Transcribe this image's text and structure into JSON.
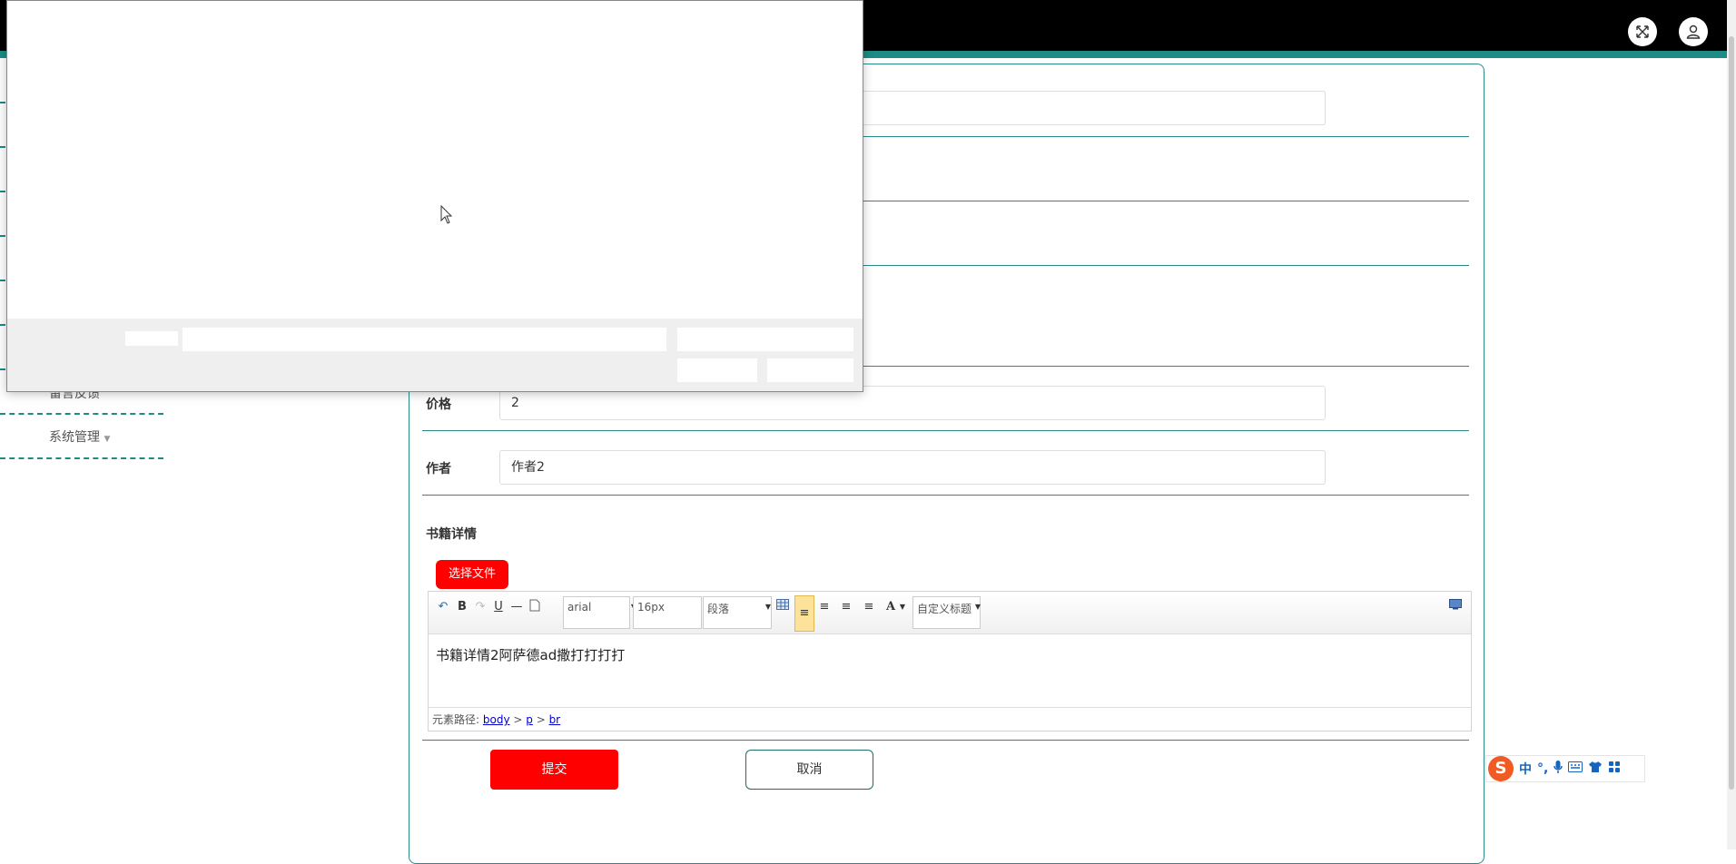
{
  "header": {
    "fullscreen_icon": "expand-arrows-icon",
    "user_icon": "user-icon"
  },
  "sidebar": {
    "items": [
      {
        "label": "留言反馈"
      },
      {
        "label": "系统管理"
      }
    ]
  },
  "form": {
    "price_label": "价格",
    "price_value": "2",
    "author_label": "作者",
    "author_value": "作者2",
    "detail_label": "书籍详情",
    "choose_file_label": "选择文件",
    "submit_label": "提交",
    "cancel_label": "取消"
  },
  "editor": {
    "font_family": "arial",
    "font_size": "16px",
    "paragraph": "段落",
    "custom_title": "自定义标题",
    "content": "书籍详情2阿萨德ad撒打打打打",
    "path_label": "元素路径:",
    "path": [
      "body",
      "p",
      "br"
    ]
  },
  "ime": {
    "logo": "S",
    "mode": "中"
  },
  "colors": {
    "accent": "#1c8c84",
    "primary_button": "#ff0000",
    "topbar": "#000000"
  }
}
